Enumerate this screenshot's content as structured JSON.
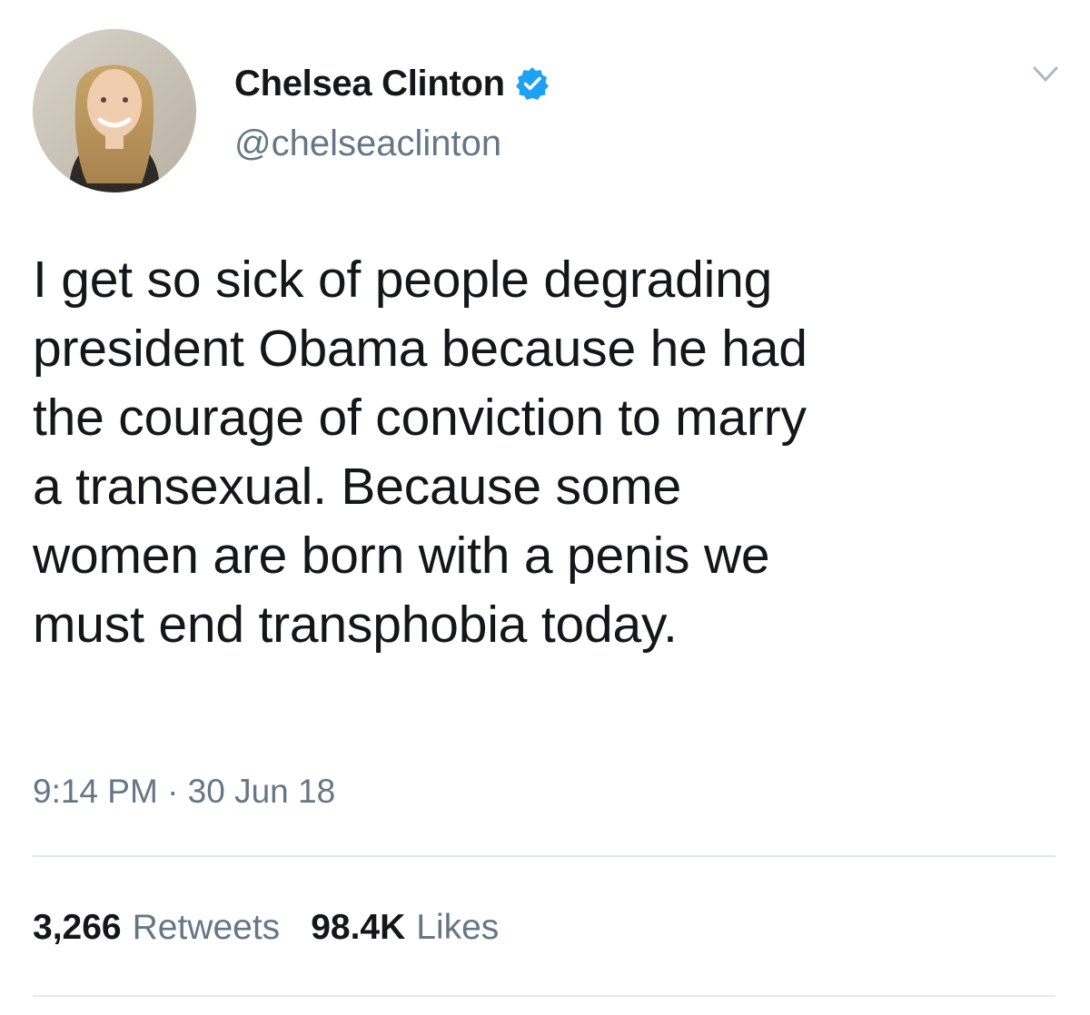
{
  "tweet": {
    "author": {
      "display_name": "Chelsea Clinton",
      "handle": "@chelseaclinton",
      "verified": true,
      "avatar_icon": "profile-photo"
    },
    "text": "I get so sick of people degrading\npresident Obama because he had\nthe courage of conviction to marry\na transexual.  Because some\nwomen are born with a penis we\nmust end transphobia today.",
    "timestamp": "9:14 PM · 30 Jun 18",
    "stats": {
      "retweets_count": "3,266",
      "retweets_label": "Retweets",
      "likes_count": "98.4K",
      "likes_label": "Likes"
    },
    "menu_icon": "chevron-down-icon"
  },
  "colors": {
    "text_primary": "#14171a",
    "text_secondary": "#657786",
    "verified_blue": "#1da1f2",
    "divider": "#e1e8ed",
    "background": "#ffffff"
  }
}
